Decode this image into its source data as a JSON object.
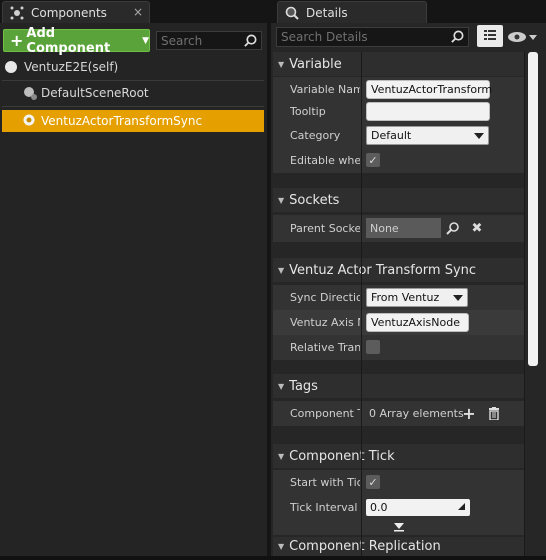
{
  "components_tab": {
    "title": "Components",
    "close": "×"
  },
  "details_tab": {
    "title": "Details"
  },
  "toolbar": {
    "add_component_label": "Add Component",
    "search_placeholder": "Search"
  },
  "tree": {
    "items": [
      {
        "label": "VentuzE2E(self)"
      },
      {
        "label": "DefaultSceneRoot"
      },
      {
        "label": "VentuzActorTransformSync"
      }
    ]
  },
  "details": {
    "search_placeholder": "Search Details",
    "sections": {
      "variable": {
        "title": "Variable",
        "variable_name_label": "Variable Name",
        "variable_name_value": "VentuzActorTransform",
        "tooltip_label": "Tooltip",
        "tooltip_value": "",
        "category_label": "Category",
        "category_value": "Default",
        "editable_label": "Editable when Inherited",
        "editable_checked": true
      },
      "sockets": {
        "title": "Sockets",
        "parent_socket_label": "Parent Socket",
        "parent_socket_value": "None"
      },
      "ventuz": {
        "title": "Ventuz Actor Transform Sync",
        "sync_direction_label": "Sync Direction",
        "sync_direction_value": "From Ventuz",
        "axis_node_label": "Ventuz Axis Node",
        "axis_node_value": "VentuzAxisNode",
        "relative_label": "Relative Transform",
        "relative_checked": false
      },
      "tags": {
        "title": "Tags",
        "component_tags_label": "Component Tags",
        "component_tags_value": "0 Array elements"
      },
      "tick": {
        "title": "Component Tick",
        "start_tick_label": "Start with Tick Enabled",
        "start_tick_checked": true,
        "tick_interval_label": "Tick Interval (secs)",
        "tick_interval_value": "0.0"
      },
      "replication": {
        "title": "Component Replication"
      }
    }
  },
  "icons": {
    "check": "✓",
    "expand": "▼",
    "add": "+",
    "trash": "🗑",
    "clear": "✖"
  }
}
